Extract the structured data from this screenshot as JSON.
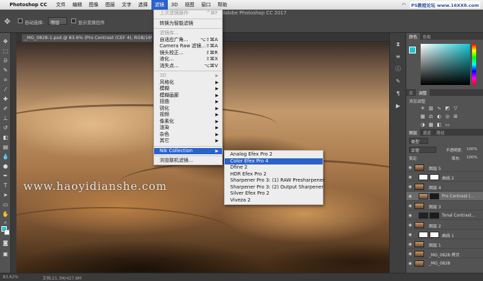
{
  "menubar": {
    "app_name": "Photoshop CC",
    "items": [
      "文件",
      "编辑",
      "图像",
      "图层",
      "文字",
      "选择",
      "滤镜",
      "3D",
      "视图",
      "窗口",
      "帮助"
    ],
    "active_index": 6,
    "watermark": "PS教程论坛 www.16XX8.com"
  },
  "window_title": "Adobe Photoshop CC 2017",
  "options_bar": {
    "auto_select_label": "自动选择:",
    "auto_select_value": "图层",
    "show_transform_label": "显示变换控件"
  },
  "document_tab": "_MG_0828-1.psd @ 83.6% (Pro Contrast (CEF 4), RGB/16*) *",
  "canvas_watermark": "www.haoyidianshe.com",
  "status": {
    "zoom": "83.62%",
    "doc_size": "文档:21.3M/427.8M"
  },
  "filter_menu": {
    "items": [
      {
        "label": "上次滤镜操作",
        "shortcut": "^⌘F",
        "disabled": true
      },
      {
        "sep": true
      },
      {
        "label": "转换为智能滤镜"
      },
      {
        "sep": true
      },
      {
        "label": "滤镜库...",
        "disabled": true
      },
      {
        "label": "自适应广角...",
        "shortcut": "⌥⇧⌘A"
      },
      {
        "label": "Camera Raw 滤镜...",
        "shortcut": "⇧⌘A"
      },
      {
        "label": "镜头校正...",
        "shortcut": "⇧⌘R"
      },
      {
        "label": "液化...",
        "shortcut": "⇧⌘X"
      },
      {
        "label": "消失点...",
        "shortcut": "⌥⌘V"
      },
      {
        "sep": true
      },
      {
        "label": "3D",
        "submenu": true,
        "disabled": true
      },
      {
        "label": "风格化",
        "submenu": true
      },
      {
        "label": "模糊",
        "submenu": true
      },
      {
        "label": "模糊画廊",
        "submenu": true
      },
      {
        "label": "扭曲",
        "submenu": true
      },
      {
        "label": "锐化",
        "submenu": true
      },
      {
        "label": "视频",
        "submenu": true
      },
      {
        "label": "像素化",
        "submenu": true
      },
      {
        "label": "渲染",
        "submenu": true
      },
      {
        "label": "杂色",
        "submenu": true
      },
      {
        "label": "其它",
        "submenu": true
      },
      {
        "sep": true
      },
      {
        "label": "Nik Collection",
        "submenu": true,
        "highlighted": true
      },
      {
        "sep": true
      },
      {
        "label": "浏览联机滤镜..."
      }
    ]
  },
  "nik_submenu": {
    "items": [
      {
        "label": "Analog Efex Pro 2"
      },
      {
        "label": "Color Efex Pro 4",
        "highlighted": true
      },
      {
        "label": "Dfine 2"
      },
      {
        "label": "HDR Efex Pro 2"
      },
      {
        "label": "Sharpener Pro 3: (1) RAW Presharpener"
      },
      {
        "label": "Sharpener Pro 3: (2) Output Sharpener"
      },
      {
        "label": "Silver Efex Pro 2"
      },
      {
        "label": "Viveza 2"
      }
    ]
  },
  "panels": {
    "color_tabs": [
      "颜色",
      "色板"
    ],
    "adjust_tabs": [
      "库",
      "调整"
    ],
    "adjust_label": "添加调整",
    "layers_tabs": [
      "图层",
      "通道",
      "路径"
    ],
    "kind_label": "类型",
    "blend_mode": "正常",
    "opacity_label": "不透明度:",
    "opacity_value": "100%",
    "lock_label": "锁定:",
    "fill_label": "填充:",
    "fill_value": "100%",
    "layers": [
      {
        "name": "图层 5",
        "thumb": "photo"
      },
      {
        "name": "曲线 2",
        "thumb": "white",
        "shifted": true
      },
      {
        "name": "图层 4",
        "thumb": "photo"
      },
      {
        "name": "Pro Contrast (...",
        "thumb": "photo",
        "selected": true,
        "shifted": true
      },
      {
        "name": "图层 3",
        "thumb": "photo"
      },
      {
        "name": "Tonal Contrast...",
        "thumb": "dark",
        "shifted": true
      },
      {
        "name": "图层 2",
        "thumb": "photo"
      },
      {
        "name": "曲线 1",
        "thumb": "white",
        "shifted": true
      },
      {
        "name": "图层 1",
        "thumb": "photo"
      },
      {
        "name": "_MG_0828 拷贝",
        "thumb": "photo"
      },
      {
        "name": "_MG_0828",
        "thumb": "photo"
      }
    ]
  }
}
